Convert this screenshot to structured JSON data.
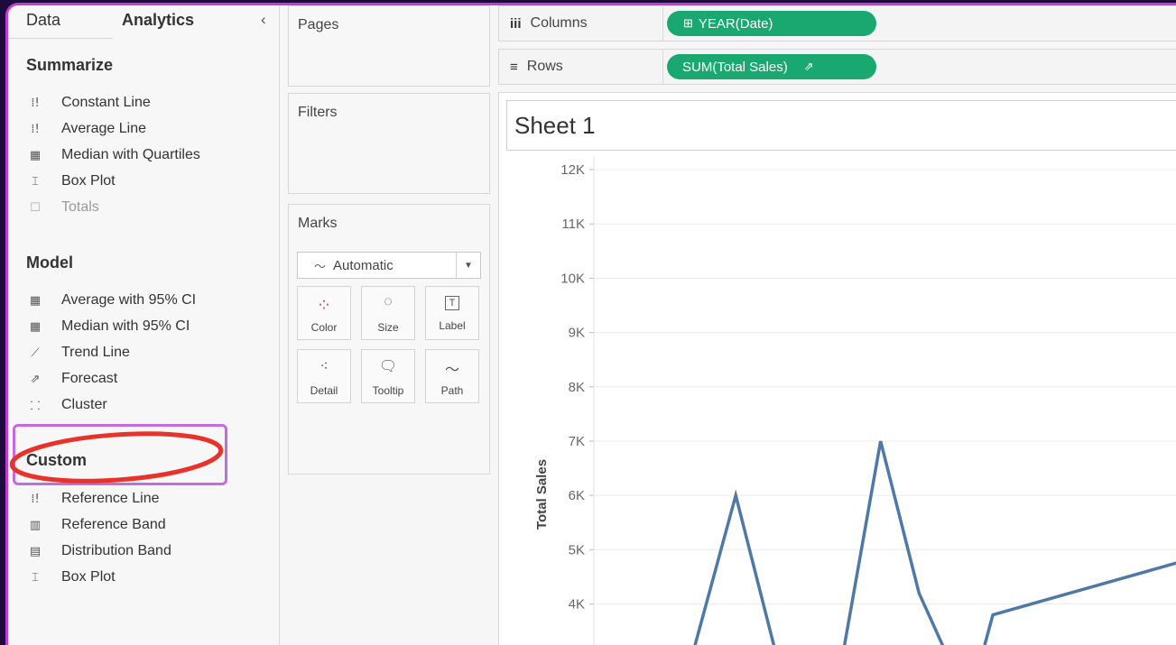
{
  "analytics_pane": {
    "tab_data": "Data",
    "tab_analytics": "Analytics",
    "collapse_glyph": "‹",
    "summarize": {
      "title": "Summarize",
      "items": [
        {
          "label": "Constant Line",
          "icon": "constant-line-icon",
          "glyph": "⁞!",
          "disabled": false
        },
        {
          "label": "Average Line",
          "icon": "average-line-icon",
          "glyph": "⁞!",
          "disabled": false
        },
        {
          "label": "Median with Quartiles",
          "icon": "median-quartiles-icon",
          "glyph": "▦",
          "disabled": false
        },
        {
          "label": "Box Plot",
          "icon": "box-plot-icon",
          "glyph": "⌶",
          "disabled": false
        },
        {
          "label": "Totals",
          "icon": "totals-icon",
          "glyph": "☐",
          "disabled": true
        }
      ]
    },
    "model": {
      "title": "Model",
      "items": [
        {
          "label": "Average with 95% CI",
          "icon": "average-ci-icon",
          "glyph": "▦"
        },
        {
          "label": "Median with 95% CI",
          "icon": "median-ci-icon",
          "glyph": "▦"
        },
        {
          "label": "Trend Line",
          "icon": "trend-line-icon",
          "glyph": "⟋"
        },
        {
          "label": "Forecast",
          "icon": "forecast-icon",
          "glyph": "⇗"
        },
        {
          "label": "Cluster",
          "icon": "cluster-icon",
          "glyph": "⸬"
        }
      ]
    },
    "custom": {
      "title": "Custom",
      "items": [
        {
          "label": "Reference Line",
          "icon": "reference-line-icon",
          "glyph": "⁞!"
        },
        {
          "label": "Reference Band",
          "icon": "reference-band-icon",
          "glyph": "▥"
        },
        {
          "label": "Distribution Band",
          "icon": "distribution-band-icon",
          "glyph": "▤"
        },
        {
          "label": "Box Plot",
          "icon": "box-plot-icon",
          "glyph": "⌶"
        }
      ]
    }
  },
  "shelves": {
    "pages_label": "Pages",
    "filters_label": "Filters",
    "marks_label": "Marks",
    "mark_type": "Automatic",
    "mark_type_glyph": "〜",
    "mark_buttons": [
      {
        "label": "Color",
        "icon": "color-icon",
        "glyph": "⁘"
      },
      {
        "label": "Size",
        "icon": "size-icon",
        "glyph": "◌"
      },
      {
        "label": "Label",
        "icon": "label-icon",
        "glyph": "T"
      },
      {
        "label": "Detail",
        "icon": "detail-icon",
        "glyph": "⁖"
      },
      {
        "label": "Tooltip",
        "icon": "tooltip-icon",
        "glyph": "🗨"
      },
      {
        "label": "Path",
        "icon": "path-icon",
        "glyph": "〜"
      }
    ]
  },
  "columns_shelf": {
    "label": "Columns",
    "glyph": "iii",
    "pill": "YEAR(Date)",
    "pill_glyph": "⊞"
  },
  "rows_shelf": {
    "label": "Rows",
    "glyph": "≡",
    "pill": "SUM(Total Sales)",
    "pill_glyph": "⇗"
  },
  "colors": {
    "pill": "#19a870",
    "line": "#4e79a7",
    "highlight_oval": "#e8332b",
    "highlight_box": "#c56be0"
  },
  "sheet_title": "Sheet 1",
  "chart_data": {
    "type": "line",
    "ylabel": "Total Sales",
    "ytick_labels": [
      "12K",
      "11K",
      "10K",
      "9K",
      "8K",
      "7K",
      "6K",
      "5K",
      "4K"
    ],
    "yticks": [
      12000,
      11000,
      10000,
      9000,
      8000,
      7000,
      6000,
      5000,
      4000
    ],
    "ylim_visible": [
      3500,
      12000
    ],
    "grid": true,
    "series": [
      {
        "values": [
          {
            "x": 0.33,
            "y": 3000
          },
          {
            "x": 0.48,
            "y": 6000
          },
          {
            "x": 0.62,
            "y": 3000
          },
          {
            "x": 0.84,
            "y": 3000
          },
          {
            "x": 0.97,
            "y": 7000
          },
          {
            "x": 1.1,
            "y": 4200
          },
          {
            "x": 1.2,
            "y": 3000
          },
          {
            "x": 1.31,
            "y": 3000
          },
          {
            "x": 1.35,
            "y": 3800
          },
          {
            "x": 2.0,
            "y": 4800
          }
        ]
      }
    ]
  }
}
